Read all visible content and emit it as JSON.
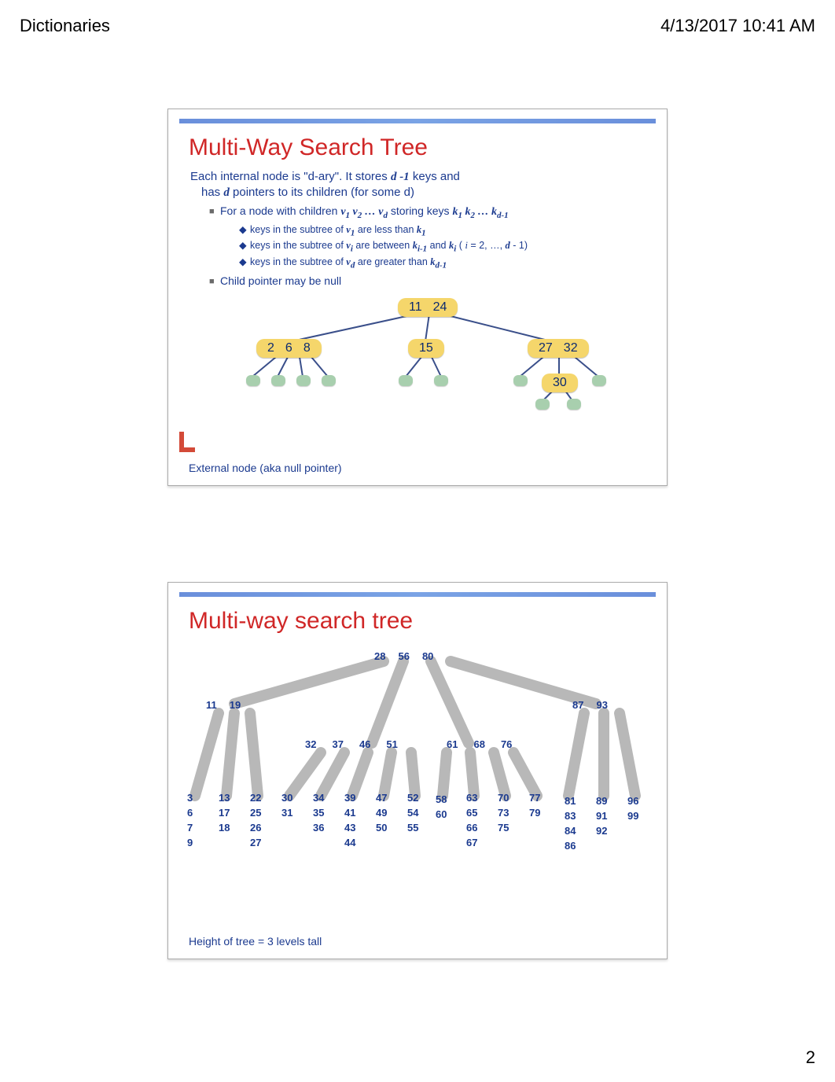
{
  "header": {
    "left": "Dictionaries",
    "right": "4/13/2017 10:41 AM",
    "page_number": "2"
  },
  "slide1": {
    "title": "Multi-Way Search Tree",
    "desc_line1_a": "Each internal node is \"d-ary\".  It stores ",
    "desc_line1_b": "d -1",
    "desc_line1_c": "  keys and",
    "desc_line2_a": "has ",
    "desc_line2_b": "d",
    "desc_line2_c": " pointers to its children (for some d)",
    "bullet1_a": "For a node with children ",
    "bullet1_b": " storing  keys ",
    "sub1_a": "keys in the subtree of  ",
    "sub1_b": " are less than ",
    "sub2_a": "keys in the subtree of  ",
    "sub2_b": " are between ",
    "sub2_c": " and ",
    "sub2_d": " (",
    "sub2_e": " = 2, …, ",
    "sub2_f": " - 1)",
    "sub3_a": "keys in the subtree of  ",
    "sub3_b": " are greater than ",
    "bullet2": "Child pointer may be null",
    "root": [
      "11",
      "24"
    ],
    "child_left": [
      "2",
      "6",
      "8"
    ],
    "child_mid": [
      "15"
    ],
    "child_right": [
      "27",
      "32"
    ],
    "grandchild": [
      "30"
    ],
    "external_note": "External node (aka null pointer)"
  },
  "slide2": {
    "title": "Multi-way search tree",
    "root": [
      "28",
      "56",
      "80"
    ],
    "level1_left": [
      "11",
      "19"
    ],
    "level1_mid": [
      "32",
      "37",
      "46",
      "51"
    ],
    "level1_mid2": [
      "61",
      "68",
      "76"
    ],
    "level1_right": [
      "87",
      "93"
    ],
    "leaves": {
      "c1": [
        "3",
        "6",
        "7",
        "9"
      ],
      "c2": [
        "13",
        "17",
        "18"
      ],
      "c3": [
        "22",
        "25",
        "26",
        "27"
      ],
      "c4": [
        "30",
        "31"
      ],
      "c5": [
        "34",
        "35",
        "36"
      ],
      "c6": [
        "39",
        "41",
        "43",
        "44"
      ],
      "c7": [
        "47",
        "49",
        "50"
      ],
      "c8": [
        "52",
        "54",
        "55"
      ],
      "c9": [
        "58",
        "60"
      ],
      "c10": [
        "63",
        "65",
        "66",
        "67"
      ],
      "c11": [
        "70",
        "73",
        "75"
      ],
      "c12": [
        "77",
        "79"
      ],
      "c13": [
        "81",
        "83",
        "84",
        "86"
      ],
      "c14": [
        "89",
        "91",
        "92"
      ],
      "c15": [
        "96",
        "99"
      ]
    },
    "height_note": "Height of tree = 3 levels tall"
  }
}
